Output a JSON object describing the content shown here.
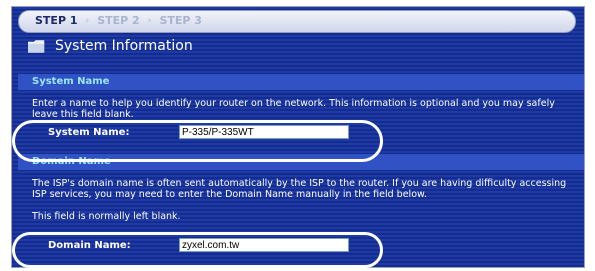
{
  "steps": [
    "STEP 1",
    "STEP 2",
    "STEP 3"
  ],
  "step_separator": "›",
  "title": "System Information",
  "system_name_section": {
    "header": "System Name",
    "description": "Enter a name to help you identify your router on the network. This information is optional and you may safely leave this field blank.",
    "label": "System Name:",
    "value": "P-335/P-335WT"
  },
  "domain_name_section": {
    "header": "Domain Name",
    "description_lines": [
      "The ISP's domain name is often sent automatically by the ISP to the router. If you are having difficulty accessing ISP services, you may need to enter the Domain Name manually in the field below.",
      "This field is normally left blank."
    ],
    "label": "Domain Name:",
    "value": "zyxel.com.tw"
  },
  "colors": {
    "background": "#17329a",
    "section_header": "#3152c4",
    "section_header_text": "#9be6ff",
    "highlight_oval": "#ffffff"
  },
  "icons": [
    "folder-icon"
  ]
}
